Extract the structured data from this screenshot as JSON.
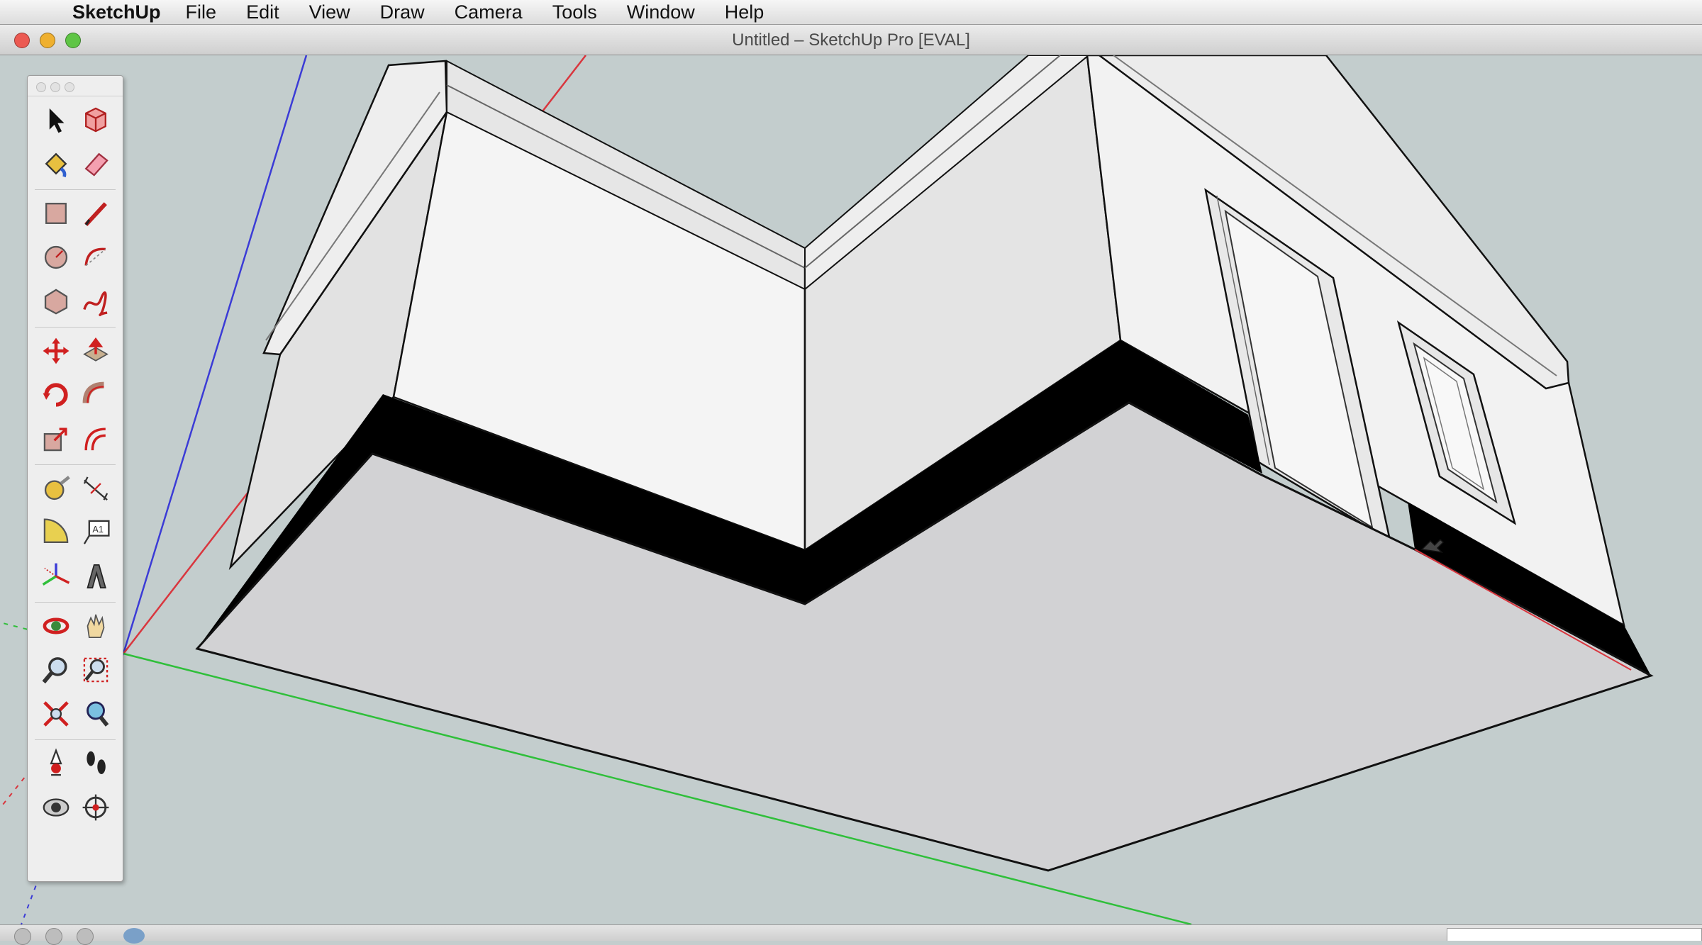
{
  "menubar": {
    "app_name": "SketchUp",
    "items": [
      "File",
      "Edit",
      "View",
      "Draw",
      "Camera",
      "Tools",
      "Window",
      "Help"
    ]
  },
  "window": {
    "title": "Untitled – SketchUp Pro [EVAL]"
  },
  "toolbar": {
    "tools": [
      {
        "name": "select-tool-icon"
      },
      {
        "name": "make-component-icon"
      },
      {
        "name": "paint-bucket-icon"
      },
      {
        "name": "eraser-icon"
      },
      {
        "name": "rectangle-icon"
      },
      {
        "name": "line-icon"
      },
      {
        "name": "circle-icon"
      },
      {
        "name": "arc-icon"
      },
      {
        "name": "polygon-icon"
      },
      {
        "name": "freehand-icon"
      },
      {
        "name": "move-icon"
      },
      {
        "name": "push-pull-icon"
      },
      {
        "name": "rotate-icon"
      },
      {
        "name": "follow-me-icon"
      },
      {
        "name": "scale-icon"
      },
      {
        "name": "offset-icon"
      },
      {
        "name": "tape-measure-icon"
      },
      {
        "name": "dimension-icon"
      },
      {
        "name": "protractor-icon"
      },
      {
        "name": "text-icon"
      },
      {
        "name": "axes-icon"
      },
      {
        "name": "3d-text-icon"
      },
      {
        "name": "orbit-icon"
      },
      {
        "name": "pan-icon"
      },
      {
        "name": "zoom-icon"
      },
      {
        "name": "zoom-window-icon"
      },
      {
        "name": "zoom-extents-icon"
      },
      {
        "name": "previous-view-icon"
      },
      {
        "name": "position-camera-icon"
      },
      {
        "name": "walk-icon"
      },
      {
        "name": "look-around-icon"
      },
      {
        "name": "section-plane-icon"
      }
    ]
  },
  "colors": {
    "background": "#c3cdcd",
    "axis_red": "#d9363e",
    "axis_green": "#2fbf3a",
    "axis_blue": "#3b3bd6",
    "wall_light": "#f3f3f3",
    "wall_shade": "#dcdcdc",
    "floor_underside": "#d2d2d4"
  }
}
